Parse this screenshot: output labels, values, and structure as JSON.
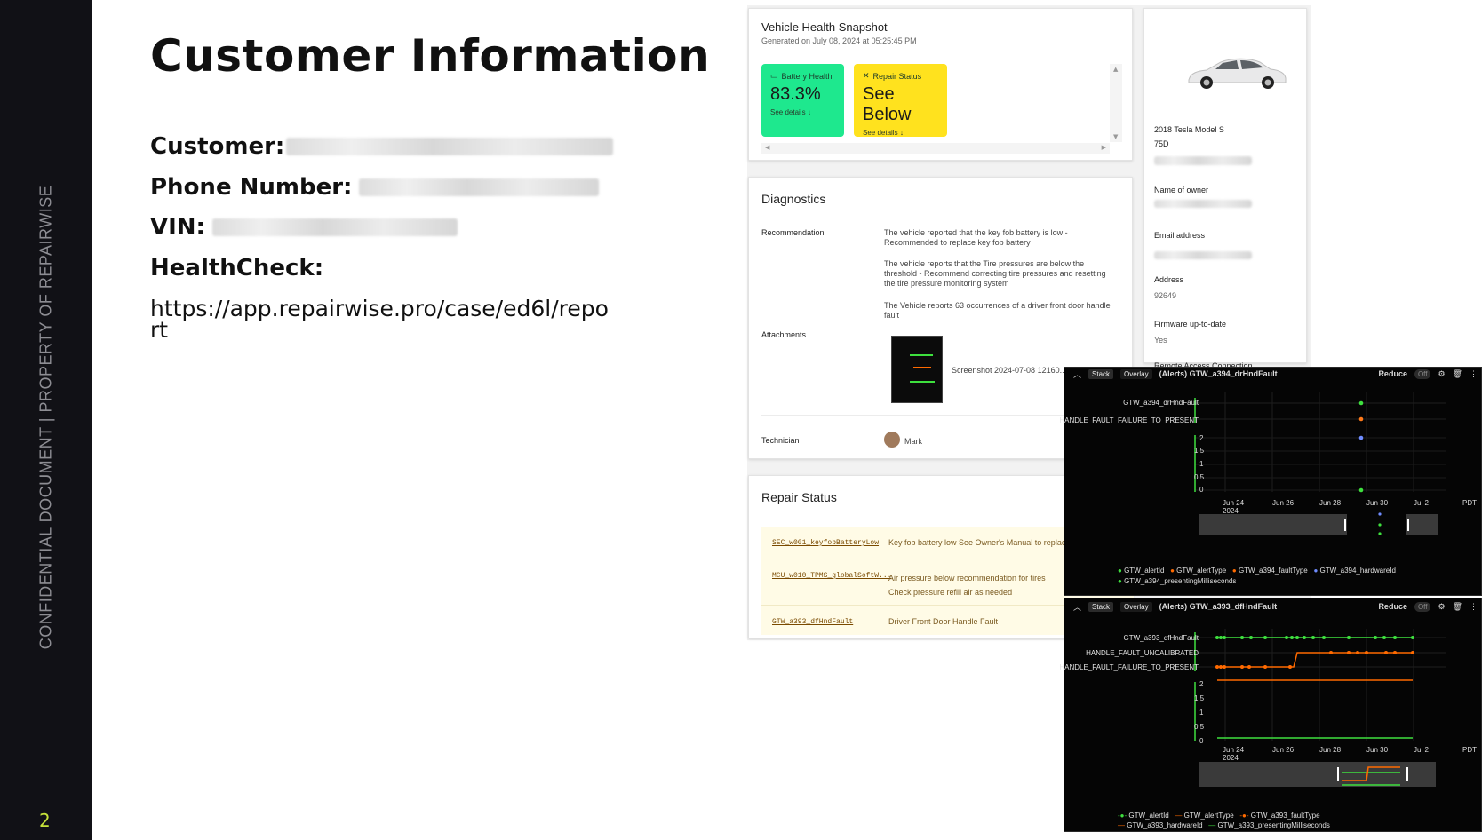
{
  "sidebar": {
    "vertical_text": "CONFIDENTIAL DOCUMENT | PROPERTY OF REPAIRWISE",
    "page_number": "2"
  },
  "slide": {
    "title": "Customer Information",
    "customer_label": "Customer:",
    "phone_label": "Phone Number:",
    "vin_label": "VIN:",
    "healthcheck_label": "HealthCheck:",
    "healthcheck_url": "https://app.repairwise.pro/case/ed6l/report"
  },
  "snapshot": {
    "title": "Vehicle Health Snapshot",
    "generated": "Generated on July 08, 2024 at 05:25:45 PM",
    "battery": {
      "label": "Battery Health",
      "value": "83.3%",
      "details": "See details",
      "color": "#1ee88e"
    },
    "repair": {
      "label": "Repair Status",
      "value": "See Below",
      "details": "See details",
      "color": "#ffe21e"
    }
  },
  "vehicle": {
    "model": "2018 Tesla Model S",
    "trim": "75D",
    "owner_label": "Name of owner",
    "email_label": "Email address",
    "address_label": "Address",
    "address_value": "92649",
    "firmware_label": "Firmware up-to-date",
    "firmware_value": "Yes",
    "remote_label": "Remote Access Connection"
  },
  "diagnostics": {
    "title": "Diagnostics",
    "recommendation_label": "Recommendation",
    "recommendations": [
      "The vehicle reported that the key fob battery is low - Recommended to replace key fob battery",
      "The vehicle reports that the Tire pressures are below the threshold - Recommend correcting tire pressures and resetting the tire pressure monitoring system",
      "The Vehicle reports 63 occurrences of a driver front door handle fault"
    ],
    "attachments_label": "Attachments",
    "attachment_name": "Screenshot 2024-07-08 12160...",
    "technician_label": "Technician",
    "technician_name": "Mark"
  },
  "repair_status": {
    "title": "Repair Status",
    "rows": [
      {
        "code": "SEC_w001_keyfobBatteryLow",
        "desc": "Key fob battery low See Owner's Manual to replace"
      },
      {
        "code": "MCU_w010_TPMS_globalSoftW...",
        "desc": "Air pressure below recommendation for tires Check pressure refill air as needed"
      },
      {
        "code": "GTW_a393_dfHndFault",
        "desc": "Driver Front Door Handle Fault"
      }
    ]
  },
  "chart_top": {
    "stack": "Stack",
    "overlay": "Overlay",
    "title": "(Alerts) GTW_a394_drHndFault",
    "reduce": "Reduce",
    "toggle": "Off",
    "tz": "PDT",
    "legend": [
      "GTW_alertId",
      "GTW_alertType",
      "GTW_a394_faultType",
      "GTW_a394_hardwareId",
      "GTW_a394_presentingMilliseconds"
    ]
  },
  "chart_bottom": {
    "stack": "Stack",
    "overlay": "Overlay",
    "title": "(Alerts) GTW_a393_dfHndFault",
    "reduce": "Reduce",
    "toggle": "Off",
    "tz": "PDT",
    "legend": [
      "GTW_alertId",
      "GTW_alertType",
      "GTW_a393_faultType",
      "GTW_a393_hardwareId",
      "GTW_a393_presentingMilliseconds"
    ]
  },
  "chart_data": [
    {
      "type": "scatter",
      "title": "(Alerts) GTW_a394_drHndFault",
      "x_ticks": [
        "Jun 24\n2024",
        "Jun 26",
        "Jun 28",
        "Jun 30",
        "Jul 2"
      ],
      "categorical_rows": [
        "GTW_a394_drHndFault",
        "HANDLE_FAULT_FAILURE_TO_PRESENT"
      ],
      "y_ticks": [
        "2",
        "1.5",
        "1",
        "0.5",
        "0"
      ],
      "series": [
        {
          "name": "GTW_alertId",
          "color": "#3ee03e",
          "points": [
            {
              "x": "Jun 30",
              "row": "GTW_a394_drHndFault"
            }
          ]
        },
        {
          "name": "GTW_alertType",
          "color": "#ff7a1a",
          "points": [
            {
              "x": "Jun 30",
              "row": "HANDLE_FAULT_FAILURE_TO_PRESENT"
            }
          ]
        },
        {
          "name": "GTW_a394_hardwareId",
          "color": "#6f8cff",
          "points": [
            {
              "x": "Jun 30",
              "y": 2
            }
          ]
        },
        {
          "name": "GTW_a394_presentingMilliseconds",
          "color": "#3ee03e",
          "points": [
            {
              "x": "Jun 30",
              "y": 0
            }
          ]
        }
      ]
    },
    {
      "type": "line",
      "title": "(Alerts) GTW_a393_dfHndFault",
      "x_ticks": [
        "Jun 24\n2024",
        "Jun 26",
        "Jun 28",
        "Jun 30",
        "Jul 2"
      ],
      "categorical_rows": [
        "GTW_a393_dfHndFault",
        "HANDLE_FAULT_UNCALIBRATED",
        "HANDLE_FAULT_FAILURE_TO_PRESENT"
      ],
      "y_ticks": [
        "2",
        "1.5",
        "1",
        "0.5",
        "0"
      ],
      "series": [
        {
          "name": "GTW_alertId",
          "color": "#3ee03e"
        },
        {
          "name": "GTW_alertType",
          "color": "#ff6a00"
        },
        {
          "name": "GTW_a393_faultType",
          "color": "#ff6a00"
        },
        {
          "name": "GTW_a393_hardwareId",
          "color": "#ff6a00"
        },
        {
          "name": "GTW_a393_presentingMilliseconds",
          "color": "#3ee03e"
        }
      ]
    }
  ]
}
